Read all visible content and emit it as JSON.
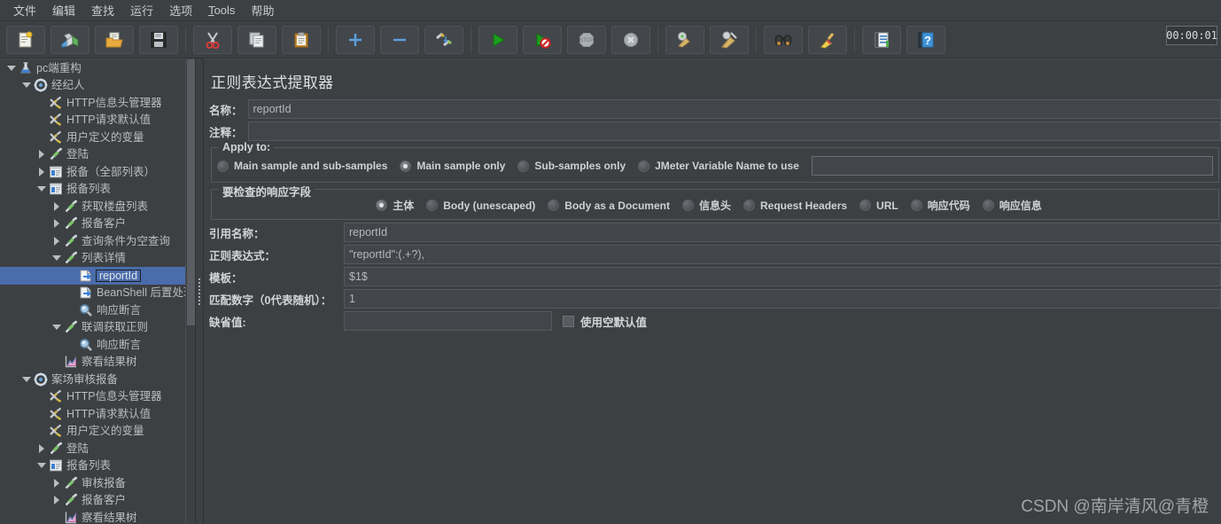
{
  "menubar": {
    "items": [
      {
        "label": "文件",
        "name": "menu-file"
      },
      {
        "label": "编辑",
        "name": "menu-edit"
      },
      {
        "label": "查找",
        "name": "menu-search"
      },
      {
        "label": "运行",
        "name": "menu-run"
      },
      {
        "label": "选项",
        "name": "menu-options"
      },
      {
        "label": "Tools",
        "name": "menu-tools"
      },
      {
        "label": "帮助",
        "name": "menu-help"
      }
    ]
  },
  "toolbar": {
    "timer": "00:00:01",
    "buttons": [
      {
        "name": "new-button",
        "icon": "new-document-icon"
      },
      {
        "name": "templates-button",
        "icon": "templates-icon"
      },
      {
        "name": "open-button",
        "icon": "open-folder-icon"
      },
      {
        "name": "save-button",
        "icon": "save-floppy-icon"
      },
      {
        "name": "cut-button",
        "icon": "scissors-icon"
      },
      {
        "name": "copy-button",
        "icon": "copy-icon"
      },
      {
        "name": "paste-button",
        "icon": "clipboard-icon"
      },
      {
        "name": "expand-all-button",
        "icon": "plus-icon"
      },
      {
        "name": "collapse-all-button",
        "icon": "minus-icon"
      },
      {
        "name": "toggle-button",
        "icon": "toggle-elements-icon"
      },
      {
        "name": "start-button",
        "icon": "play-icon"
      },
      {
        "name": "start-no-pauses-button",
        "icon": "play-no-pause-icon"
      },
      {
        "name": "stop-button",
        "icon": "stop-icon"
      },
      {
        "name": "shutdown-button",
        "icon": "shutdown-icon"
      },
      {
        "name": "clear-button",
        "icon": "clear-broom-icon"
      },
      {
        "name": "clear-all-button",
        "icon": "clear-all-broom-icon"
      },
      {
        "name": "search-button",
        "icon": "binoculars-icon"
      },
      {
        "name": "reset-search-button",
        "icon": "broom-icon"
      },
      {
        "name": "function-helper-button",
        "icon": "function-helper-icon"
      },
      {
        "name": "help-button",
        "icon": "help-book-icon"
      }
    ]
  },
  "tree": {
    "nodes": [
      {
        "label": "pc端重构",
        "depth": 0,
        "toggle": "down",
        "icon": "test-plan-icon",
        "selected": false
      },
      {
        "label": "经纪人",
        "depth": 1,
        "toggle": "down",
        "icon": "thread-group-icon",
        "selected": false
      },
      {
        "label": "HTTP信息头管理器",
        "depth": 2,
        "toggle": "none",
        "icon": "config-icon",
        "selected": false
      },
      {
        "label": "HTTP请求默认值",
        "depth": 2,
        "toggle": "none",
        "icon": "config-icon",
        "selected": false
      },
      {
        "label": "用户定义的变量",
        "depth": 2,
        "toggle": "none",
        "icon": "config-icon",
        "selected": false
      },
      {
        "label": "登陆",
        "depth": 2,
        "toggle": "right",
        "icon": "sampler-icon",
        "selected": false
      },
      {
        "label": "报备（全部列表）",
        "depth": 2,
        "toggle": "right",
        "icon": "controller-icon",
        "selected": false
      },
      {
        "label": "报备列表",
        "depth": 2,
        "toggle": "down",
        "icon": "controller-icon",
        "selected": false
      },
      {
        "label": "获取楼盘列表",
        "depth": 3,
        "toggle": "right",
        "icon": "sampler-icon",
        "selected": false
      },
      {
        "label": "报备客户",
        "depth": 3,
        "toggle": "right",
        "icon": "sampler-icon",
        "selected": false
      },
      {
        "label": "查询条件为空查询",
        "depth": 3,
        "toggle": "right",
        "icon": "sampler-icon",
        "selected": false
      },
      {
        "label": "列表详情",
        "depth": 3,
        "toggle": "down",
        "icon": "sampler-icon",
        "selected": false
      },
      {
        "label": "reportId",
        "depth": 4,
        "toggle": "none",
        "icon": "post-processor-icon",
        "selected": true
      },
      {
        "label": "BeanShell 后置处理程序",
        "depth": 4,
        "toggle": "none",
        "icon": "post-processor-icon",
        "selected": false
      },
      {
        "label": "响应断言",
        "depth": 4,
        "toggle": "none",
        "icon": "assertion-icon",
        "selected": false
      },
      {
        "label": "联调获取正则",
        "depth": 3,
        "toggle": "down",
        "icon": "sampler-icon",
        "selected": false
      },
      {
        "label": "响应断言",
        "depth": 4,
        "toggle": "none",
        "icon": "assertion-icon",
        "selected": false
      },
      {
        "label": "察看结果树",
        "depth": 3,
        "toggle": "none",
        "icon": "listener-icon",
        "selected": false
      },
      {
        "label": "案场审核报备",
        "depth": 1,
        "toggle": "down",
        "icon": "thread-group-icon",
        "selected": false
      },
      {
        "label": "HTTP信息头管理器",
        "depth": 2,
        "toggle": "none",
        "icon": "config-icon",
        "selected": false
      },
      {
        "label": "HTTP请求默认值",
        "depth": 2,
        "toggle": "none",
        "icon": "config-icon",
        "selected": false
      },
      {
        "label": "用户定义的变量",
        "depth": 2,
        "toggle": "none",
        "icon": "config-icon",
        "selected": false
      },
      {
        "label": "登陆",
        "depth": 2,
        "toggle": "right",
        "icon": "sampler-icon",
        "selected": false
      },
      {
        "label": "报备列表",
        "depth": 2,
        "toggle": "down",
        "icon": "controller-icon",
        "selected": false
      },
      {
        "label": "审核报备",
        "depth": 3,
        "toggle": "right",
        "icon": "sampler-icon",
        "selected": false
      },
      {
        "label": "报备客户",
        "depth": 3,
        "toggle": "right",
        "icon": "sampler-icon",
        "selected": false
      },
      {
        "label": "察看结果树",
        "depth": 3,
        "toggle": "none",
        "icon": "listener-icon",
        "selected": false
      }
    ]
  },
  "main": {
    "title": "正则表达式提取器",
    "name_label": "名称：",
    "name_value": "reportId",
    "comment_label": "注释：",
    "comment_value": "",
    "apply_to": {
      "title": "Apply to:",
      "options": [
        {
          "label": "Main sample and sub-samples",
          "selected": false,
          "name": "radio-main-and-sub"
        },
        {
          "label": "Main sample only",
          "selected": true,
          "name": "radio-main-only"
        },
        {
          "label": "Sub-samples only",
          "selected": false,
          "name": "radio-sub-only"
        },
        {
          "label": "JMeter Variable Name to use",
          "selected": false,
          "name": "radio-jmeter-variable"
        }
      ],
      "variable_value": ""
    },
    "field_to_check": {
      "title": "要检查的响应字段",
      "options": [
        {
          "label": "主体",
          "selected": true,
          "name": "radio-body"
        },
        {
          "label": "Body (unescaped)",
          "selected": false,
          "name": "radio-body-unescaped"
        },
        {
          "label": "Body as a Document",
          "selected": false,
          "name": "radio-body-as-document"
        },
        {
          "label": "信息头",
          "selected": false,
          "name": "radio-response-headers"
        },
        {
          "label": "Request Headers",
          "selected": false,
          "name": "radio-request-headers"
        },
        {
          "label": "URL",
          "selected": false,
          "name": "radio-url"
        },
        {
          "label": "响应代码",
          "selected": false,
          "name": "radio-response-code"
        },
        {
          "label": "响应信息",
          "selected": false,
          "name": "radio-response-message"
        }
      ]
    },
    "fields": [
      {
        "label": "引用名称：",
        "value": "reportId",
        "name": "reference-name"
      },
      {
        "label": "正则表达式：",
        "value": "\"reportId\":(.+?),",
        "name": "regular-expression"
      },
      {
        "label": "模板：",
        "value": "$1$",
        "name": "template"
      },
      {
        "label": "匹配数字（0代表随机）：",
        "value": "1",
        "name": "match-number"
      }
    ],
    "default_value_label": "缺省值:",
    "default_value": "",
    "use_empty_default_label": "使用空默认值",
    "use_empty_default_checked": false
  },
  "watermark": "CSDN @南岸清风@青橙"
}
